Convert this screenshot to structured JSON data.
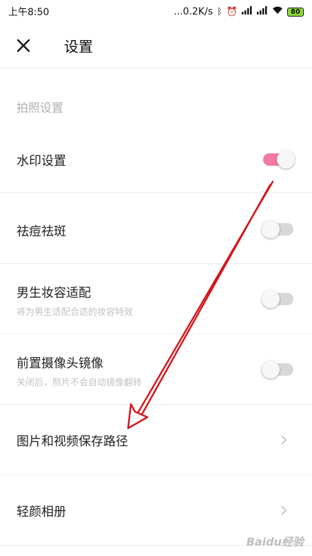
{
  "status_bar": {
    "time": "上午8:50",
    "network_speed": "...0.2K/s",
    "icons": [
      "bluetooth-icon",
      "alarm-icon",
      "signal-icon",
      "signal-icon",
      "wifi-icon",
      "battery-icon"
    ],
    "battery": "80"
  },
  "header": {
    "title": "设置",
    "close_icon": "close-icon"
  },
  "section": {
    "title": "拍照设置"
  },
  "settings": [
    {
      "label": "水印设置",
      "description": "",
      "control": "toggle",
      "value": true
    },
    {
      "label": "祛痘祛斑",
      "description": "",
      "control": "toggle",
      "value": false
    },
    {
      "label": "男生妆容适配",
      "description": "将为男生适配合适的妆容特效",
      "control": "toggle",
      "value": false
    },
    {
      "label": "前置摄像头镜像",
      "description": "关闭后，照片不会自动镜像翻转",
      "control": "toggle",
      "value": false
    },
    {
      "label": "图片和视频保存路径",
      "description": "",
      "control": "chevron"
    },
    {
      "label": "轻颜相册",
      "description": "",
      "control": "chevron"
    }
  ],
  "colors": {
    "toggle_on": "#f47aa0",
    "toggle_off": "#d8d8d8",
    "annotation_arrow": "#d4151b"
  },
  "watermark": "Baidu经验"
}
